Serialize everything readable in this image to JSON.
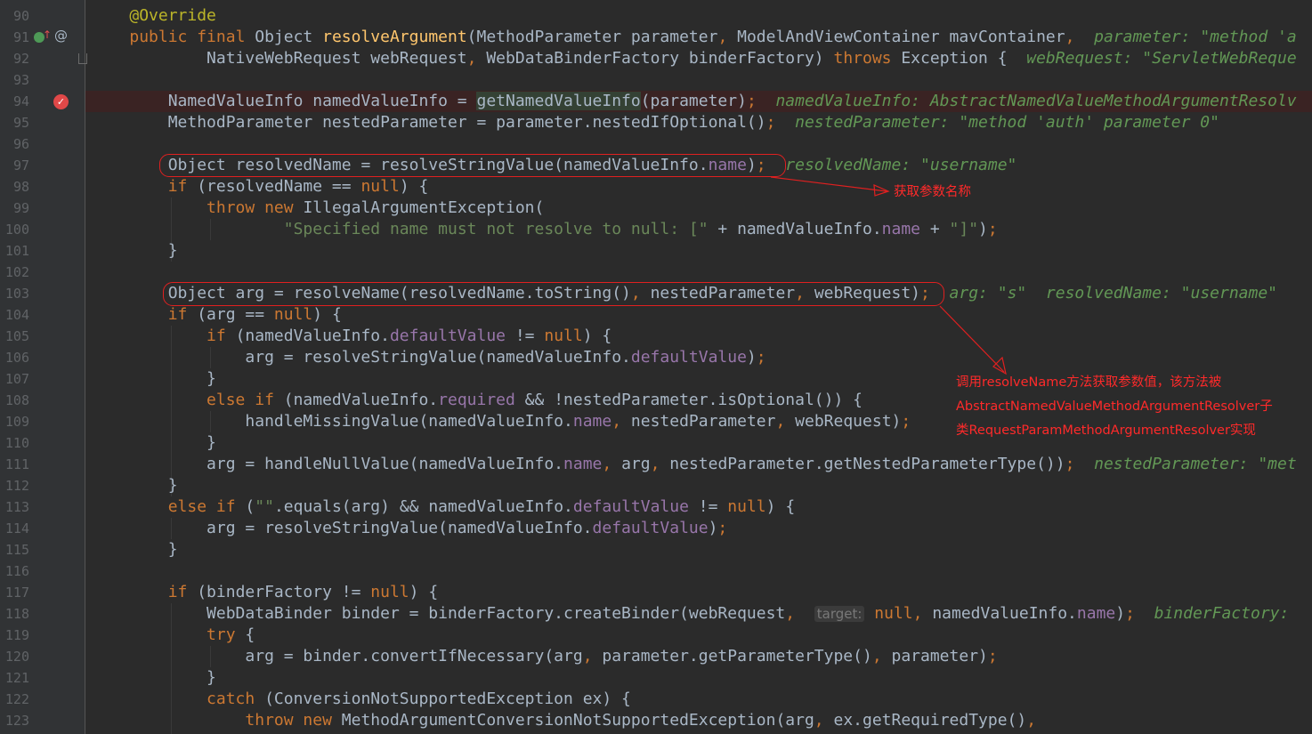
{
  "line_numbers": [
    "90",
    "91",
    "92",
    "93",
    "94",
    "95",
    "96",
    "97",
    "98",
    "99",
    "100",
    "101",
    "102",
    "103",
    "104",
    "105",
    "106",
    "107",
    "108",
    "109",
    "110",
    "111",
    "112",
    "113",
    "114",
    "115",
    "116",
    "117",
    "118",
    "119",
    "120",
    "121",
    "122",
    "123"
  ],
  "code": {
    "l90": {
      "annotation": "@Override"
    },
    "l91": {
      "mods": "public final ",
      "t1": "Object ",
      "method": "resolveArgument",
      "p1": "(MethodParameter parameter",
      "c1": ", ",
      "p2": "ModelAndViewContainer mavContainer",
      "c2": ",  ",
      "hint": "parameter: \"method 'a"
    },
    "l92": {
      "p3": "NativeWebRequest webRequest",
      "c3": ", ",
      "p4": "WebDataBinderFactory binderFactory) ",
      "throws": "throws ",
      "exc": "Exception {  ",
      "hint": "webRequest: \"ServletWebReque"
    },
    "l94": {
      "a": "NamedValueInfo namedValueInfo = ",
      "call": "getNamedValueInfo",
      "b": "(parameter)",
      "semi": ";  ",
      "hint": "namedValueInfo: AbstractNamedValueMethodArgumentResolv"
    },
    "l95": {
      "a": "MethodParameter nestedParameter = parameter.nestedIfOptional()",
      "semi": ";  ",
      "hint": "nestedParameter: \"method 'auth' parameter 0\""
    },
    "l97": {
      "a": "Object resolvedName = resolveStringValue(namedValueInfo.",
      "f": "name",
      "b": ")",
      "semi": ";  ",
      "hint": "resolvedName: \"username\""
    },
    "l98": {
      "if": "if ",
      "a": "(resolvedName == ",
      "null": "null",
      "b": ") {"
    },
    "l99": {
      "throw": "throw ",
      "new": "new ",
      "a": "IllegalArgumentException("
    },
    "l100": {
      "s": "\"Specified name must not resolve to null: [\" ",
      "a": "+ namedValueInfo.",
      "f": "name",
      "b": " + ",
      "s2": "\"]\"",
      "c": ")",
      "semi": ";"
    },
    "l101": {
      "a": "}"
    },
    "l103": {
      "a": "Object arg = resolveName(resolvedName.toString()",
      "c1": ", ",
      "b": "nestedParameter",
      "c2": ", ",
      "d": "webRequest)",
      "semi": ";  ",
      "hint1": "arg: \"s\"  ",
      "hint2": "resolvedName: \"username\""
    },
    "l104": {
      "if": "if ",
      "a": "(arg == ",
      "null": "null",
      "b": ") {"
    },
    "l105": {
      "if": "if ",
      "a": "(namedValueInfo.",
      "f": "defaultValue",
      "b": " != ",
      "null": "null",
      "c": ") {"
    },
    "l106": {
      "a": "arg = resolveStringValue(namedValueInfo.",
      "f": "defaultValue",
      "b": ")",
      "semi": ";"
    },
    "l107": {
      "a": "}"
    },
    "l108": {
      "else": "else if ",
      "a": "(namedValueInfo.",
      "f": "required",
      "b": " && !nestedParameter.isOptional()) {"
    },
    "l109": {
      "a": "handleMissingValue(namedValueInfo.",
      "f": "name",
      "c1": ", ",
      "b": "nestedParameter",
      "c2": ", ",
      "d": "webRequest)",
      "semi": ";"
    },
    "l110": {
      "a": "}"
    },
    "l111": {
      "a": "arg = handleNullValue(namedValueInfo.",
      "f": "name",
      "c1": ", ",
      "b": "arg",
      "c2": ", ",
      "d": "nestedParameter.getNestedParameterType())",
      "semi": ";  ",
      "hint": "nestedParameter: \"met"
    },
    "l112": {
      "a": "}"
    },
    "l113": {
      "else": "else if ",
      "a": "(",
      "s": "\"\"",
      "b": ".equals(arg) && namedValueInfo.",
      "f": "defaultValue",
      "c": " != ",
      "null": "null",
      "d": ") {"
    },
    "l114": {
      "a": "arg = resolveStringValue(namedValueInfo.",
      "f": "defaultValue",
      "b": ")",
      "semi": ";"
    },
    "l115": {
      "a": "}"
    },
    "l117": {
      "if": "if ",
      "a": "(binderFactory != ",
      "null": "null",
      "b": ") {"
    },
    "l118": {
      "a": "WebDataBinder binder = binderFactory.createBinder(webRequest",
      "c1": ",  ",
      "label": "target:",
      "null": " null",
      "c2": ", ",
      "b": "namedValueInfo.",
      "f": "name",
      "c": ")",
      "semi": ";  ",
      "hint": "binderFactory:"
    },
    "l119": {
      "try": "try ",
      "a": "{"
    },
    "l120": {
      "a": "arg = binder.convertIfNecessary(arg",
      "c1": ", ",
      "b": "parameter.getParameterType()",
      "c2": ", ",
      "d": "parameter)",
      "semi": ";"
    },
    "l121": {
      "a": "}"
    },
    "l122": {
      "catch": "catch ",
      "a": "(ConversionNotSupportedException ex) {"
    },
    "l123": {
      "throw": "throw ",
      "new": "new ",
      "a": "MethodArgumentConversionNotSupportedException(arg",
      "c1": ", ",
      "b": "ex.getRequiredType()",
      "c2": ","
    }
  },
  "notes": {
    "n1": "获取参数名称",
    "n2_line1": "调用resolveName方法获取参数值，该方法被",
    "n2_line2": "AbstractNamedValueMethodArgumentResolver子",
    "n2_line3": "类RequestParamMethodArgumentResolver实现"
  },
  "colors": {
    "background": "#2b2b2b",
    "keyword": "#cc7832",
    "string": "#6a8759",
    "field": "#9876aa",
    "method": "#ffc66d",
    "annotation_marker": "#e02020"
  }
}
